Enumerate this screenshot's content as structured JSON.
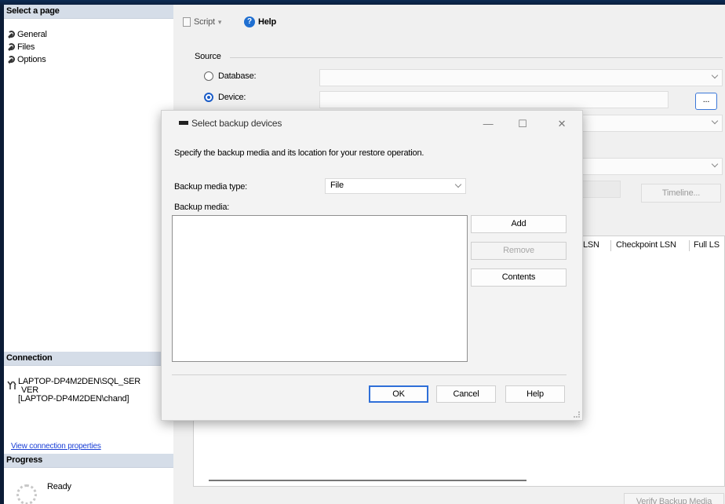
{
  "left_panel": {
    "select_page_header": "Select a page",
    "pages": [
      {
        "label": "General"
      },
      {
        "label": "Files"
      },
      {
        "label": "Options"
      }
    ],
    "connection_header": "Connection",
    "connection_server": "LAPTOP-DP4M2DEN\\SQL_SERVER",
    "connection_server_line1": "LAPTOP-DP4M2DEN\\SQL_SER",
    "connection_server_line2": "VER",
    "connection_user": "[LAPTOP-DP4M2DEN\\chand]",
    "view_connection_link": "View connection properties",
    "progress_header": "Progress",
    "progress_status": "Ready"
  },
  "toolbar": {
    "script_label": "Script",
    "help_label": "Help"
  },
  "source": {
    "section_label": "Source",
    "database_label": "Database:",
    "device_label": "Device:",
    "device_browse_label": "...",
    "timeline_label": "Timeline...",
    "columns": [
      "LSN",
      "Checkpoint LSN",
      "Full LS"
    ],
    "verify_label": "Verify Backup Media"
  },
  "dialog": {
    "title": "Select backup devices",
    "instruction": "Specify the backup media and its location for your restore operation.",
    "media_type_label": "Backup media type:",
    "media_type_value": "File",
    "media_label": "Backup media:",
    "add_label": "Add",
    "remove_label": "Remove",
    "contents_label": "Contents",
    "ok_label": "OK",
    "cancel_label": "Cancel",
    "help_label": "Help",
    "minimize_glyph": "—",
    "maximize_glyph": "☐",
    "close_glyph": "✕"
  }
}
